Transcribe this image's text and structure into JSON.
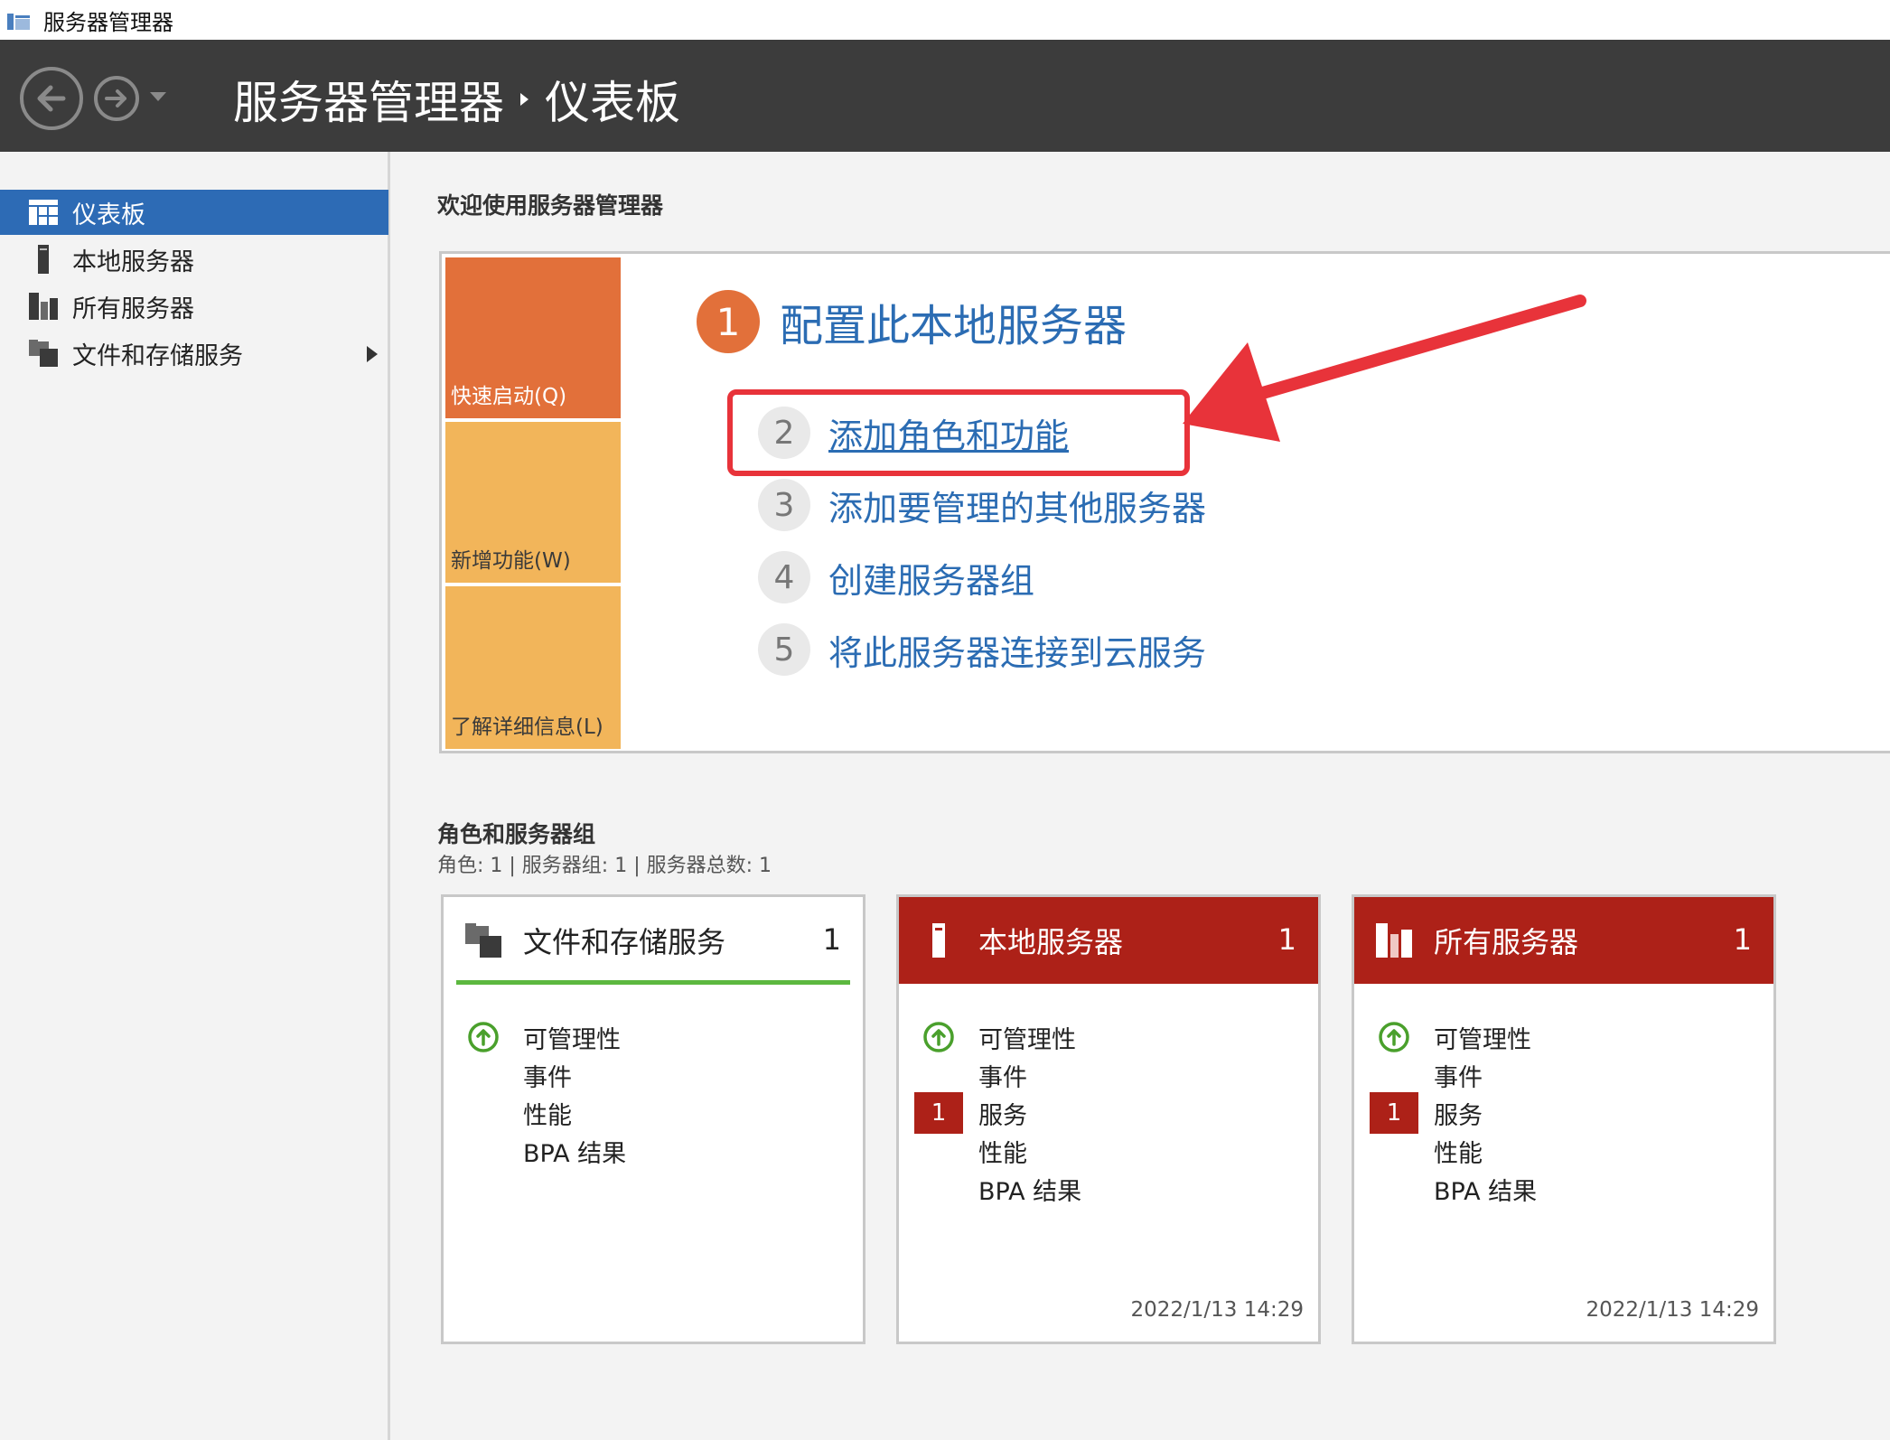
{
  "window": {
    "title": "服务器管理器"
  },
  "header": {
    "breadcrumb": [
      "服务器管理器",
      "仪表板"
    ]
  },
  "sidebar": {
    "items": [
      {
        "label": "仪表板",
        "active": true,
        "icon": "dashboard-icon"
      },
      {
        "label": "本地服务器",
        "active": false,
        "icon": "local-server-icon"
      },
      {
        "label": "所有服务器",
        "active": false,
        "icon": "all-servers-icon"
      },
      {
        "label": "文件和存储服务",
        "active": false,
        "icon": "file-storage-icon",
        "has_submenu": true
      }
    ]
  },
  "welcome": {
    "title": "欢迎使用服务器管理器",
    "tiles": [
      "快速启动(Q)",
      "新增功能(W)",
      "了解详细信息(L)"
    ],
    "steps": [
      {
        "num": "1",
        "label": "配置此本地服务器"
      },
      {
        "num": "2",
        "label": "添加角色和功能"
      },
      {
        "num": "3",
        "label": "添加要管理的其他服务器"
      },
      {
        "num": "4",
        "label": "创建服务器组"
      },
      {
        "num": "5",
        "label": "将此服务器连接到云服务"
      }
    ]
  },
  "roles": {
    "title": "角色和服务器组",
    "summary": "角色: 1 | 服务器组: 1 | 服务器总数: 1",
    "cards": [
      {
        "title": "文件和存储服务",
        "count": "1",
        "style": "normal",
        "rows": [
          "可管理性",
          "事件",
          "性能",
          "BPA 结果"
        ],
        "timestamp": ""
      },
      {
        "title": "本地服务器",
        "count": "1",
        "style": "alert",
        "rows": [
          "可管理性",
          "事件",
          "服务",
          "性能",
          "BPA 结果"
        ],
        "service_badge": "1",
        "timestamp": "2022/1/13 14:29"
      },
      {
        "title": "所有服务器",
        "count": "1",
        "style": "alert",
        "rows": [
          "可管理性",
          "事件",
          "服务",
          "性能",
          "BPA 结果"
        ],
        "service_badge": "1",
        "timestamp": "2022/1/13 14:29"
      }
    ]
  },
  "colors": {
    "header_bg": "#3c3c3c",
    "active_nav": "#2d6bb5",
    "tile_orange": "#e2703a",
    "tile_light": "#f2b55a",
    "link_blue": "#2b6cb3",
    "alert_red": "#ad2118",
    "ok_green": "#4aa02c",
    "annotation_red": "#e8333a"
  }
}
